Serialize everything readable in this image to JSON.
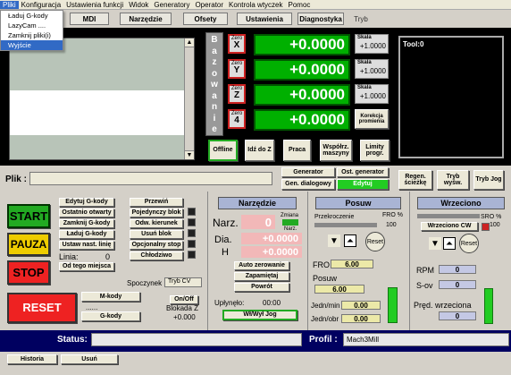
{
  "menu": {
    "items": [
      "Pliki",
      "Konfiguracja",
      "Ustawienia funkcji",
      "Widok",
      "Generatory",
      "Operator",
      "Kontrola wtyczek",
      "Pomoc"
    ],
    "dropdown": [
      "Ładuj G-kody",
      "LazyCam ....",
      "Zamknij pliki(i)",
      "Wyjście"
    ]
  },
  "tabs": [
    "MDI",
    "Narzędzie",
    "Ofsety",
    "Ustawienia",
    "Diagnostyka",
    "Tryb"
  ],
  "dro": {
    "side_label": [
      "B",
      "a",
      "z",
      "o",
      "w",
      "a",
      "n",
      "i",
      "e"
    ],
    "axes": [
      {
        "zero": "Zero",
        "axis": "X",
        "value": "+0.0000",
        "scale_label": "Skala",
        "scale_value": "+1.0000"
      },
      {
        "zero": "Zero",
        "axis": "Y",
        "value": "+0.0000",
        "scale_label": "Skala",
        "scale_value": "+1.0000"
      },
      {
        "zero": "Zero",
        "axis": "Z",
        "value": "+0.0000",
        "scale_label": "Skala",
        "scale_value": "+1.0000"
      },
      {
        "zero": "Zero",
        "axis": "4",
        "value": "+0.0000",
        "scale_label": "Korekcja",
        "scale_value": "promienia"
      }
    ],
    "bottom_buttons": [
      "Offline",
      "Idź do Z",
      "Praca",
      "Współrz. maszyny",
      "Limity progr."
    ]
  },
  "tool_display": "Tool:0",
  "file": {
    "label": "Plik :",
    "value": ""
  },
  "generator": {
    "gen_label": "Generator",
    "gen_dialog": "Gen. dialogowy",
    "os_gen": "Ost. generator",
    "edit": "Edytuj"
  },
  "regen_buttons": [
    "Regen. ścieżkę",
    "Tryb wyśw.",
    "Tryb Jog"
  ],
  "program": {
    "buttons_left": [
      "Edytuj G-kody",
      "Ostatnio otwarty",
      "Zamknij G-kody",
      "Ładuj G-kody",
      "Ustaw nast. linię"
    ],
    "line_label": "Linia:",
    "line_value": "0",
    "from_here": "Od tego miejsca",
    "buttons_right": [
      "Przewiń",
      "Pojedynczy blok",
      "Odw. kierunek",
      "Usuń blok",
      "Opcjonalny stop",
      "Chłodziwo"
    ],
    "spoczynek_label": "Spoczynek",
    "spoczynek_value": "Tryb CV"
  },
  "controls": {
    "start": "START",
    "pauza": "PAUZA",
    "stop": "STOP",
    "reset": "RESET"
  },
  "mcodes": {
    "mkody": "M-kody",
    "dots": "......",
    "gkody": "G-kody",
    "onoff": "On/Off",
    "blokada": "Blokada Z",
    "blokada_value": "+0.000"
  },
  "narzedzie": {
    "title": "Narzędzie",
    "narz_label": "Narz.",
    "narz_value": "0",
    "zmiana": "Zmiana",
    "narz_small": "Narz.",
    "dia_label": "Dia.",
    "dia_value": "+0.0000",
    "h_label": "H",
    "h_value": "+0.0000",
    "auto": "Auto zerowanie",
    "zapamietaj": "Zapamiętaj",
    "powrot": "Powrót",
    "uplynelo": "Upłynęło:",
    "uplynelo_value": "00:00",
    "jog": "Wł/Wył Jog"
  },
  "posuw": {
    "title": "Posuw",
    "przekroczenie": "Przekroczenie",
    "fro_pct_label": "FRO %",
    "fro_pct_value": "100",
    "reset": "Reset",
    "fro_label": "FRO",
    "fro_value": "6.00",
    "posuw_label": "Posuw",
    "posuw_value": "6.00",
    "jedn_min_label": "Jedn/min",
    "jedn_min_value": "0.00",
    "jedn_obr_label": "Jedn/obr",
    "jedn_obr_value": "0.00"
  },
  "wrzeciono": {
    "title": "Wrzeciono",
    "sro_label": "SRO %",
    "sro_value": "100",
    "cw": "Wrzeciono CW",
    "reset": "Reset",
    "rpm_label": "RPM",
    "rpm_value": "0",
    "sov_label": "S-ov",
    "sov_value": "0",
    "pred_label": "Pręd. wrzeciona",
    "pred_value": "0"
  },
  "status": {
    "label": "Status:",
    "value": "",
    "profil_label": "Profil :",
    "profil_value": "Mach3Mill"
  },
  "bottom": {
    "historia": "Historia",
    "usun": "Usuń"
  }
}
